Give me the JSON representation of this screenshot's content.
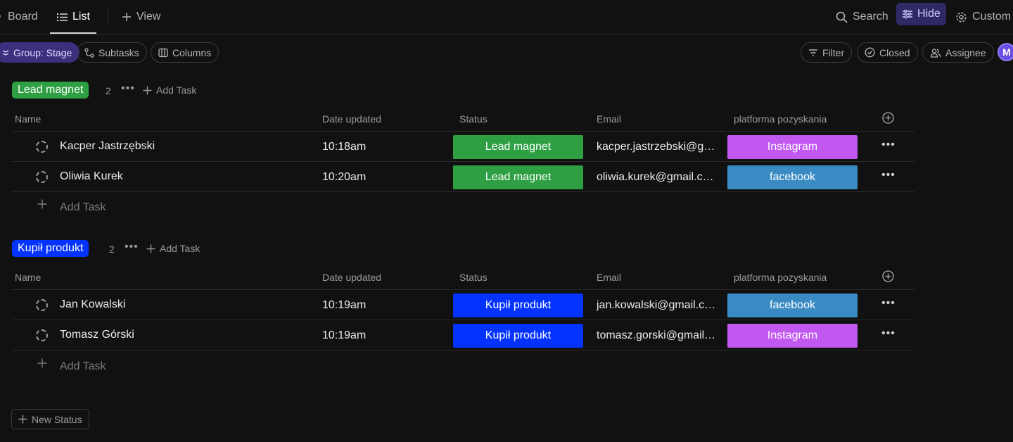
{
  "tabs": {
    "board": "Board",
    "list": "List",
    "add_view": "View"
  },
  "toolbar": {
    "search": "Search",
    "hide": "Hide",
    "customize": "Custom"
  },
  "chips": {
    "group": "Group: Stage",
    "subtasks": "Subtasks",
    "columns": "Columns",
    "filter": "Filter",
    "closed": "Closed",
    "assignee": "Assignee"
  },
  "avatar": {
    "initial": "M"
  },
  "columns": {
    "name": "Name",
    "date": "Date updated",
    "status": "Status",
    "email": "Email",
    "platform": "platforma pozyskania"
  },
  "colors": {
    "lead_magnet": "#2ea043",
    "kupil_produkt": "#0433ff",
    "instagram": "#c158f0",
    "facebook": "#3a8bc4"
  },
  "groups": [
    {
      "name": "Lead magnet",
      "count": "2",
      "add_task": "Add Task",
      "add_task_row": "Add Task",
      "rows": [
        {
          "name": "Kacper Jastrzębski",
          "date": "10:18am",
          "status": "Lead magnet",
          "email": "kacper.jastrzebski@gmail.com",
          "platform": "Instagram"
        },
        {
          "name": "Oliwia Kurek",
          "date": "10:20am",
          "status": "Lead magnet",
          "email": "oliwia.kurek@gmail.com",
          "platform": "facebook"
        }
      ]
    },
    {
      "name": "Kupił produkt",
      "count": "2",
      "add_task": "Add Task",
      "add_task_row": "Add Task",
      "rows": [
        {
          "name": "Jan Kowalski",
          "date": "10:19am",
          "status": "Kupił produkt",
          "email": "jan.kowalski@gmail.com",
          "platform": "facebook"
        },
        {
          "name": "Tomasz Górski",
          "date": "10:19am",
          "status": "Kupił produkt",
          "email": "tomasz.gorski@gmail.com",
          "platform": "Instagram"
        }
      ]
    }
  ],
  "new_status": "New Status"
}
